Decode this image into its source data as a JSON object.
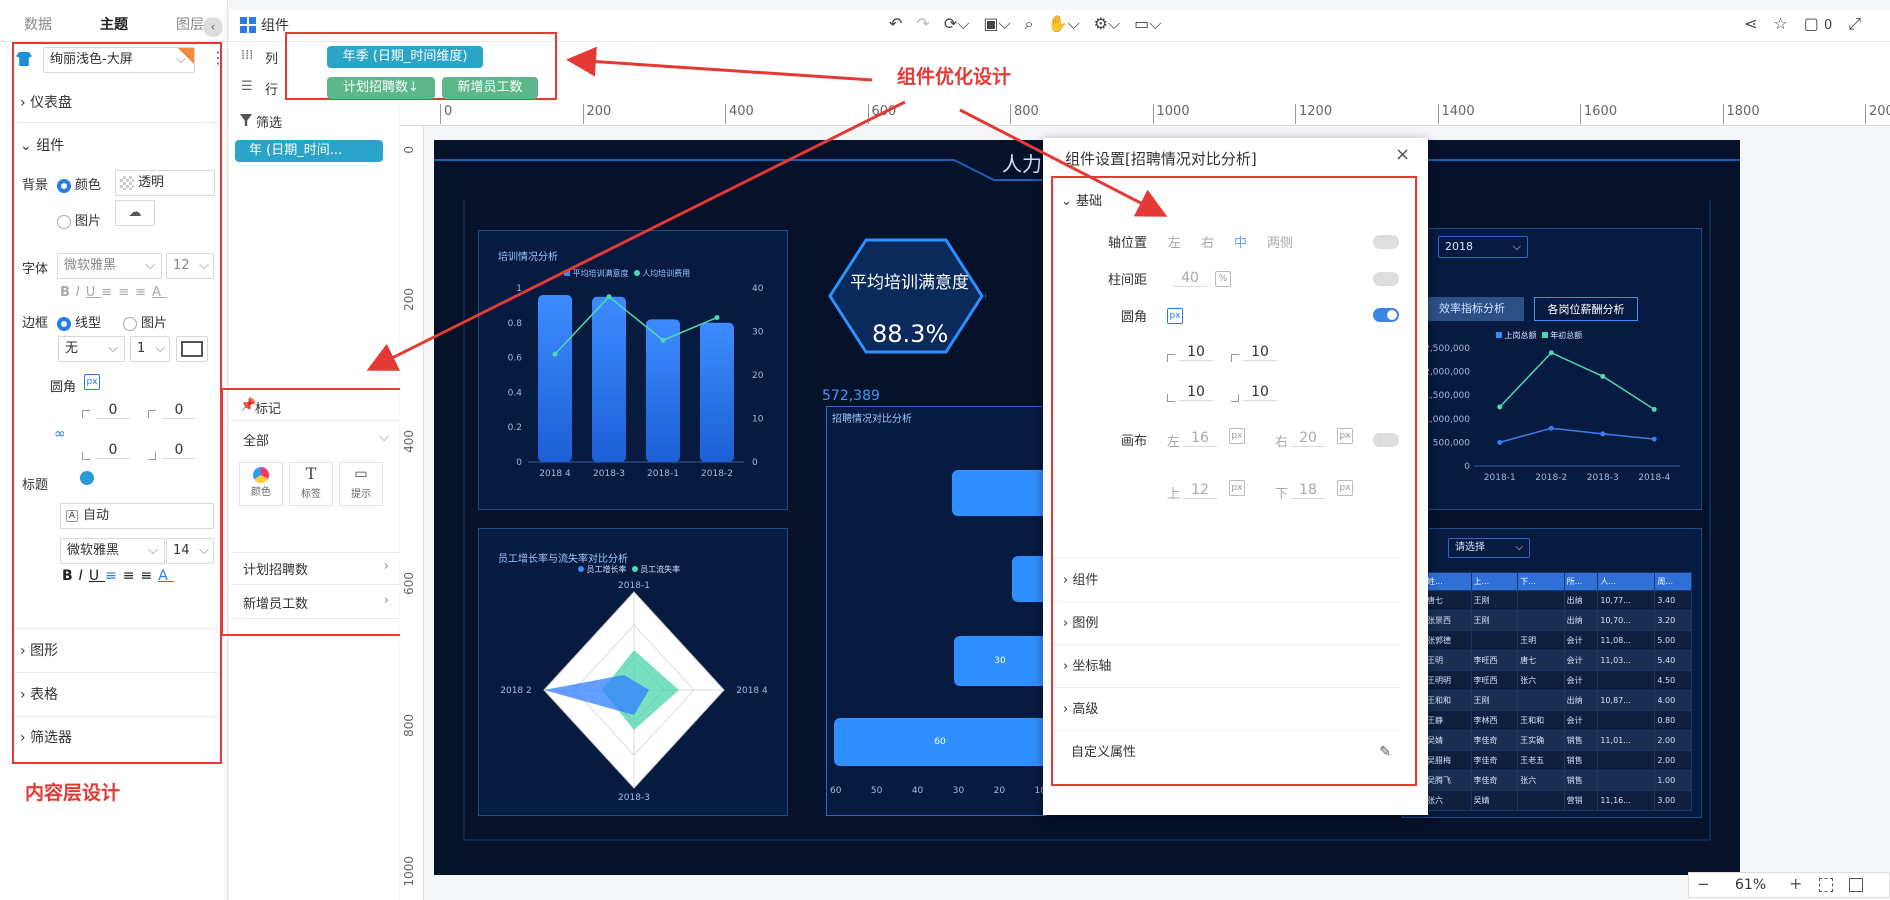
{
  "left_tabs": [
    "数据",
    "主题",
    "图层"
  ],
  "theme": {
    "name": "绚丽浅色-大屏"
  },
  "sections": {
    "dashboard": "仪表盘",
    "component": "组件",
    "shape": "图形",
    "table": "表格",
    "filter": "筛选器"
  },
  "component": {
    "background_label": "背景",
    "color_opt": "颜色",
    "transparent": "透明",
    "image_opt": "图片",
    "font_label": "字体",
    "font_value": "微软雅黑",
    "font_size": "12",
    "border_label": "边框",
    "line_opt": "线型",
    "image_opt2": "图片",
    "border_none": "无",
    "border_width": "1",
    "radius_label": "圆角",
    "radius_vals": [
      "0",
      "0",
      "0",
      "0"
    ],
    "title_label": "标题",
    "title_auto": "自动",
    "title_font": "微软雅黑",
    "title_size": "14"
  },
  "left_annotation": "内容层设计",
  "mid": {
    "col_label": "列",
    "row_label": "行",
    "col_pill": "年季 (日期_时间维度)",
    "row_pills": [
      "计划招聘数↓",
      "新增员工数"
    ],
    "filter_label": "筛选",
    "filter_pill": "年 (日期_时间...",
    "marks_title": "标记",
    "marks_all": "全部",
    "mark_buttons": [
      "颜色",
      "标签",
      "提示"
    ],
    "measures": [
      "计划招聘数",
      "新增员工数"
    ]
  },
  "topbar": {
    "title": "组件",
    "comments": "0"
  },
  "annotation_top": "组件优化设计",
  "ruler": [
    "0",
    "200",
    "400",
    "600",
    "800",
    "1000",
    "1200",
    "1400",
    "1600",
    "1800",
    "2000"
  ],
  "vruler": [
    "0",
    "200",
    "400",
    "600",
    "800",
    "1000"
  ],
  "board": {
    "title_partial": "人力",
    "train_title": "培训情况分析",
    "legend1": [
      "平均培训满意度",
      "人均培训费用"
    ],
    "hex_title": "平均培训满意度",
    "hex_value": "88.3%",
    "big_number": "572,389",
    "recruit_title": "招聘情况对比分析",
    "staff_title": "员工增长率与流失率对比分析",
    "legend2": [
      "员工增长率",
      "员工流失率"
    ],
    "radar_labels": [
      "2018-1",
      "2018 4",
      "2018-3",
      "2018 2"
    ],
    "year_select": "2018",
    "tabs": [
      "效率指标分析",
      "各岗位薪酬分析"
    ],
    "legend3": [
      "上岗总额",
      "年初总额"
    ],
    "select2": "请选择",
    "hbar_labels": [
      "30",
      "60"
    ],
    "hbar_ticks": [
      "60",
      "50",
      "40",
      "30",
      "20",
      "10"
    ]
  },
  "chart_data": [
    {
      "type": "bar",
      "categories": [
        "2018 4",
        "2018-3",
        "2018-1",
        "2018-2"
      ],
      "values": [
        0.96,
        0.95,
        0.82,
        0.8
      ],
      "title": "培训情况分析",
      "ylim": [
        0,
        1
      ],
      "y_ticks": [
        "0",
        "0.2",
        "0.4",
        "0.6",
        "0.8",
        "1"
      ],
      "y2_ticks": [
        "0",
        "10",
        "20",
        "30",
        "40"
      ],
      "line_values": [
        0.62,
        0.95,
        0.7,
        0.83
      ]
    },
    {
      "type": "line",
      "categories": [
        "2018-1",
        "2018-2",
        "2018-3",
        "2018-4"
      ],
      "series": [
        {
          "name": "上岗总额",
          "values": [
            500000,
            800000,
            680000,
            570000
          ]
        },
        {
          "name": "年初总额",
          "values": [
            1250000,
            2400000,
            1900000,
            1200000
          ]
        }
      ],
      "ylim": [
        0,
        2500000
      ],
      "y_ticks": [
        "0",
        "500,000",
        "1,000,000",
        "1,500,000",
        "2,000,000",
        "2,500,000"
      ]
    }
  ],
  "table": {
    "headers": [
      "姓...",
      "上...",
      "下...",
      "所...",
      "人...",
      "周..."
    ],
    "rows": [
      [
        "唐七",
        "王刚",
        "",
        "出纳",
        "10,77...",
        "3.40"
      ],
      [
        "张景西",
        "王刚",
        "",
        "出纳",
        "10,70...",
        "3.20"
      ],
      [
        "张郭德",
        "",
        "王明",
        "会计",
        "11,08...",
        "5.00"
      ],
      [
        "王明",
        "李旺西",
        "唐七",
        "会计",
        "11,03...",
        "5.40"
      ],
      [
        "王明明",
        "李旺西",
        "张六",
        "会计",
        "",
        "4.50"
      ],
      [
        "王和和",
        "王刚",
        "",
        "出纳",
        "10,87...",
        "4.00"
      ],
      [
        "王静",
        "李林西",
        "王和和",
        "会计",
        "",
        "0.80"
      ],
      [
        "吴婧",
        "李佳奇",
        "王实确",
        "销售",
        "11,01...",
        "2.00"
      ],
      [
        "吴腊梅",
        "李佳奇",
        "王老五",
        "销售",
        "",
        "2.00"
      ],
      [
        "吴腾飞",
        "李佳奇",
        "张六",
        "销售",
        "",
        "1.00"
      ],
      [
        "张六",
        "吴婧",
        "",
        "营销",
        "11,16...",
        "3.00"
      ]
    ]
  },
  "dialog": {
    "title": "组件设置[招聘情况对比分析]",
    "basic": "基础",
    "axis_pos": "轴位置",
    "axis_opts": [
      "左",
      "右",
      "中",
      "两侧"
    ],
    "bar_gap": "柱间距",
    "bar_gap_val": "40",
    "pct": "%",
    "radius": "圆角",
    "px": "px",
    "radius_vals": [
      "10",
      "10",
      "10",
      "10"
    ],
    "canvas": "画布",
    "left": "左",
    "left_val": "16",
    "right": "右",
    "right_val": "20",
    "top": "上",
    "top_val": "12",
    "bottom": "下",
    "bottom_val": "18",
    "sections": [
      "组件",
      "图例",
      "坐标轴",
      "高级"
    ],
    "custom": "自定义属性"
  },
  "zoom": {
    "minus": "−",
    "value": "61%",
    "plus": "+"
  }
}
